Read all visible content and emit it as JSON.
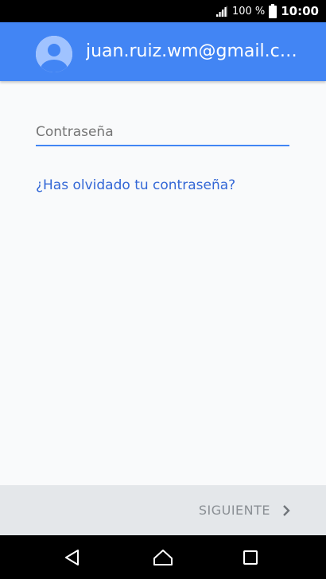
{
  "status_bar": {
    "battery_percent": "100 %",
    "time": "10:00",
    "icons": [
      "signal-icon",
      "battery-icon"
    ]
  },
  "header": {
    "email": "juan.ruiz.wm@gmail.c…",
    "avatar_icon": "default-avatar-icon",
    "color": "#4285f4"
  },
  "form": {
    "password_placeholder": "Contraseña",
    "password_value": "",
    "forgot_link": "¿Has olvidado tu contraseña?"
  },
  "footer": {
    "next_label": "SIGUIENTE",
    "next_icon": "chevron-right-icon"
  },
  "nav_bar": {
    "icons": [
      "back-icon",
      "home-icon",
      "recents-icon"
    ]
  },
  "colors": {
    "accent": "#4285f4",
    "link": "#3367d6",
    "disabled_text": "#8a8f94"
  }
}
